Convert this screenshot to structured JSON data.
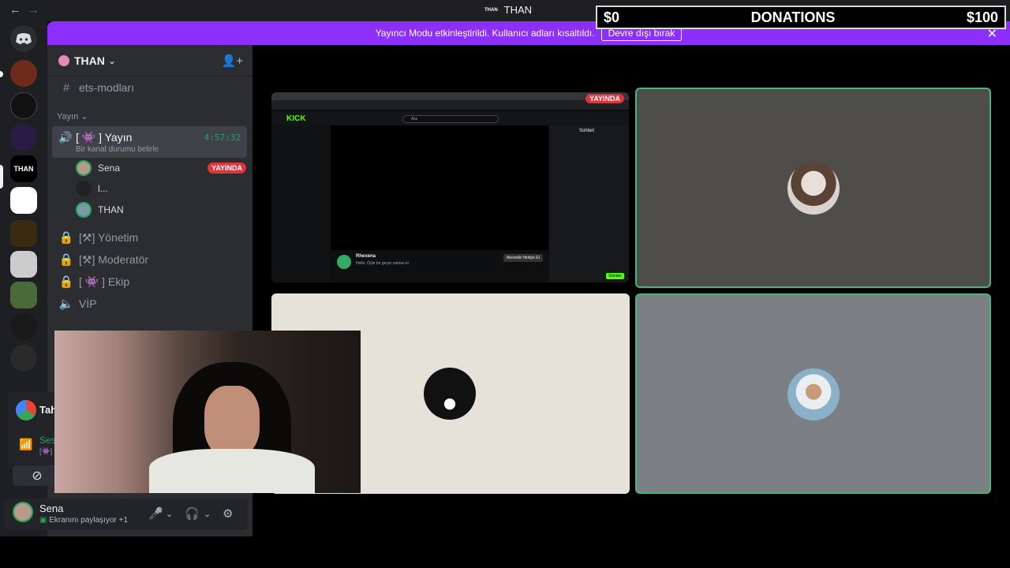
{
  "window": {
    "title": "THAN",
    "title_mini": "THAN",
    "nav_back": "←",
    "nav_forward": "→"
  },
  "donations": {
    "left": "$0",
    "center": "DONATIONS",
    "right": "$100"
  },
  "banner": {
    "message": "Yayıncı Modu etkinleştirildi. Kullanıcı adları kısaltıldı.",
    "button": "Devre dışı bırak",
    "close": "✕"
  },
  "server": {
    "name": "THAN",
    "chevron": "⌄"
  },
  "rail": {
    "guilds": [
      "discord-home",
      "pumpkins",
      "bolt",
      "draxul",
      "than",
      "ai",
      "vs",
      "gamer",
      "pixel",
      "valorant",
      "roblox"
    ],
    "partial_label": "Tah",
    "partial_voice": "Ses",
    "partial_voice_sub": "[👾]"
  },
  "channels": {
    "text_top": "ets-modları",
    "category": "Yayın",
    "voice": {
      "label": "[ 👾 ] Yayın",
      "status": "Bir kanal durumu belirle",
      "timer": "4:57:32"
    },
    "members": [
      {
        "name": "Sena",
        "live": "YAYINDA"
      },
      {
        "name": "l..."
      },
      {
        "name": "THAN"
      }
    ],
    "locked": [
      "[⚒] Yönetim",
      "[⚒] Moderatör",
      "[ 👾 ] Ekip"
    ],
    "vip": "VİP"
  },
  "share": {
    "live": "YAYINDA",
    "site_logo": "KICK",
    "search": "Ara",
    "streamer": "Rhexena",
    "stream_title": "Hello, Öyle bir geçer zaman ki",
    "chat_header": "Sohbet",
    "subscribe": "Abonelik Hediye Et",
    "send": "Gönder"
  },
  "user": {
    "name": "Sena",
    "status": "Ekranını paylaşıyor +1"
  }
}
